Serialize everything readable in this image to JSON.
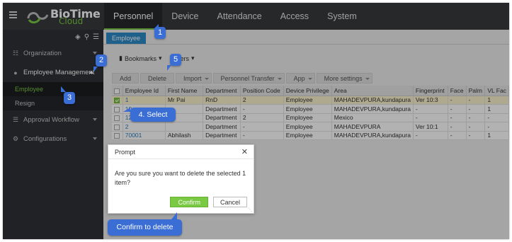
{
  "app": {
    "brand_main": "BioTime",
    "brand_sub": "Cloud"
  },
  "top_nav": [
    {
      "label": "Personnel"
    },
    {
      "label": "Device"
    },
    {
      "label": "Attendance"
    },
    {
      "label": "Access"
    },
    {
      "label": "System"
    }
  ],
  "sidebar": {
    "items": [
      {
        "label": "Organization",
        "icon": "org-chart-icon"
      },
      {
        "label": "Employee Management",
        "icon": "users-icon"
      },
      {
        "label": "Approval Workflow",
        "icon": "list-icon"
      },
      {
        "label": "Configurations",
        "icon": "gears-icon"
      }
    ],
    "sub_items": [
      {
        "label": "Employee"
      },
      {
        "label": "Resign"
      }
    ]
  },
  "page_tab": "Employee",
  "filters": {
    "bookmarks": "Bookmarks",
    "filters": "Filters"
  },
  "toolbar": [
    "Add",
    "Delete",
    "Import",
    "Personnel Transfer",
    "App",
    "More settings"
  ],
  "table": {
    "columns": [
      "Employee Id",
      "First Name",
      "Department",
      "Position Code",
      "Device Privilege",
      "Area",
      "Fingerprint",
      "Face",
      "Palm",
      "VL Fac"
    ],
    "rows": [
      [
        "1",
        "Mr Pai",
        "RnD",
        "2",
        "Employee",
        "MAHADEVPURA,kundapura",
        "Ver 10:3",
        "-",
        "-",
        "1"
      ],
      [
        "10",
        "c",
        "Department",
        "-",
        "Employee",
        "MAHADEVPURA,kundapura",
        "-",
        "-",
        "-",
        "1"
      ],
      [
        "12",
        "",
        "Department",
        "2",
        "Employee",
        "Mexico",
        "-",
        "-",
        "-",
        "-"
      ],
      [
        "2",
        "",
        "Department",
        "-",
        "Employee",
        "MAHADEVPURA",
        "Ver 10:1",
        "-",
        "-",
        "-"
      ],
      [
        "70001",
        "Abhilash",
        "Department",
        "-",
        "Employee",
        "MAHADEVPURA,kundapura",
        "-",
        "-",
        "-",
        "1"
      ]
    ]
  },
  "dialog": {
    "title": "Prompt",
    "message": "Are you sure you want to delete the selected 1 item?",
    "confirm": "Confirm",
    "cancel": "Cancel"
  },
  "callouts": {
    "step1": "1",
    "step2": "2",
    "step3": "3",
    "step4": "4. Select",
    "step5": "5",
    "step6": "Confirm to delete"
  },
  "colors": {
    "accent_green": "#7ac943",
    "callout_blue": "#3b6ed5",
    "tab_blue": "#2d8cc8"
  }
}
